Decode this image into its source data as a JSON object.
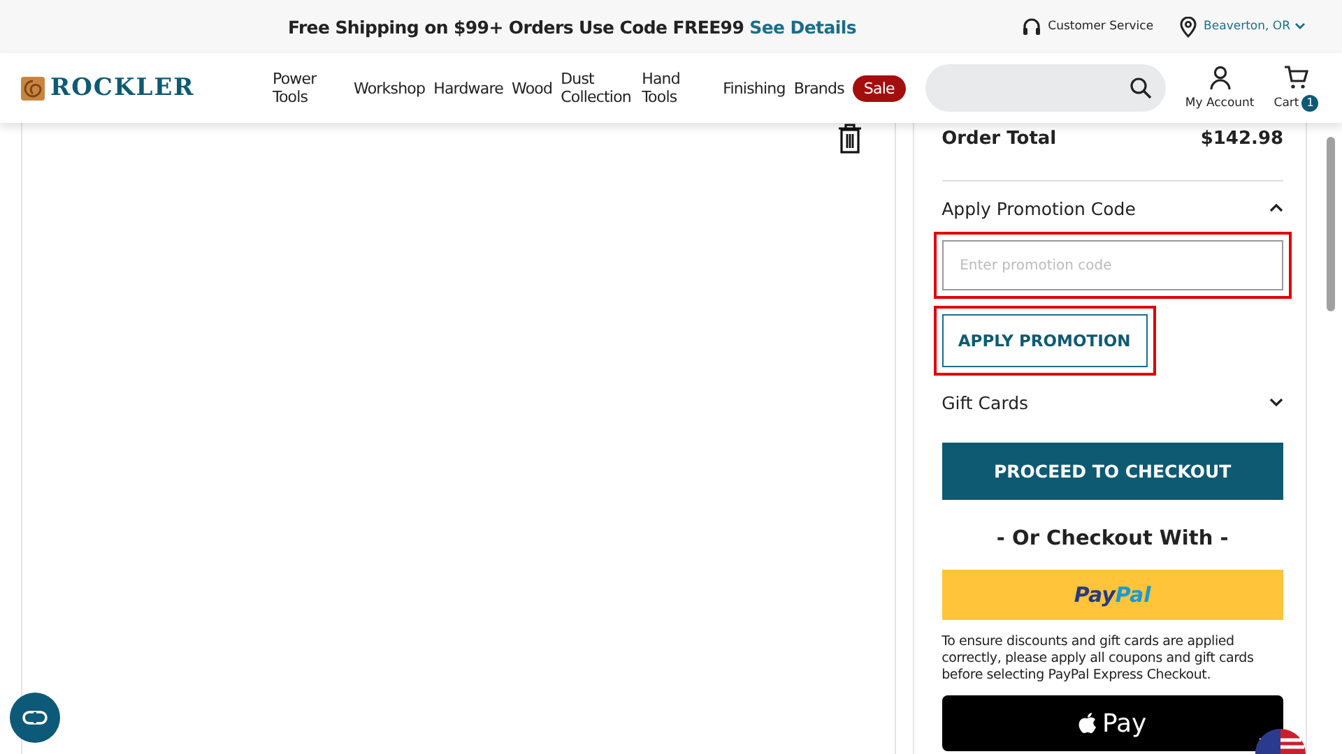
{
  "promo_bar": {
    "text": "Free Shipping on $99+ Orders Use Code FREE99",
    "link": "See Details",
    "customer_service": "Customer Service",
    "location": "Beaverton, OR"
  },
  "header": {
    "logo": "ROCKLER",
    "nav": [
      {
        "label": "Power Tools",
        "kind": "link"
      },
      {
        "label": "Workshop",
        "kind": "link"
      },
      {
        "label": "Hardware",
        "kind": "link"
      },
      {
        "label": "Wood",
        "kind": "link"
      },
      {
        "label": "Dust Collection",
        "kind": "link"
      },
      {
        "label": "Hand Tools",
        "kind": "link"
      },
      {
        "label": "Finishing",
        "kind": "link"
      },
      {
        "label": "Brands",
        "kind": "link"
      },
      {
        "label": "Sale",
        "kind": "pill"
      }
    ],
    "account": "My Account",
    "cart": "Cart",
    "cart_count": "1"
  },
  "summary": {
    "order_total_label": "Order Total",
    "order_total": "$142.98",
    "promotion": {
      "title": "Apply Promotion Code",
      "expanded": true,
      "placeholder": "Enter promotion code",
      "field_highlighted": true,
      "button": "APPLY PROMOTION",
      "button_highlighted": true
    },
    "gift_cards": {
      "title": "Gift Cards",
      "expanded": false
    },
    "checkout_button": "PROCEED TO CHECKOUT",
    "alt_heading": "- Or Checkout With -",
    "paypal": [
      "Pay",
      "Pal"
    ],
    "paypal_note": "To ensure discounts and gift cards are applied correctly, please apply all coupons and gift cards before selecting PayPal Express Checkout.",
    "apple_pay": "Pay"
  }
}
